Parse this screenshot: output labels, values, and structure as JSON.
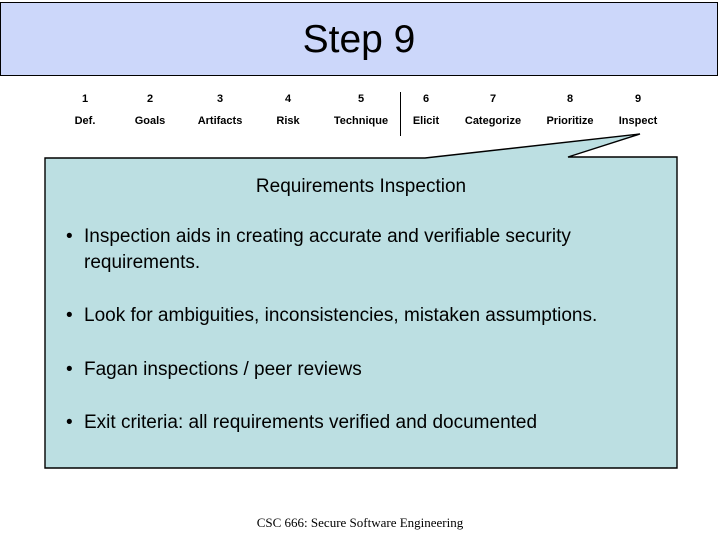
{
  "slide": {
    "title": "Step 9",
    "footer": "CSC 666: Secure Software Engineering",
    "banner_color": "#ccd7fa",
    "callout_color": "#bcdfe2",
    "border_color": "#000000"
  },
  "process_steps": [
    {
      "number": "1",
      "label": "Def."
    },
    {
      "number": "2",
      "label": "Goals"
    },
    {
      "number": "3",
      "label": "Artifacts"
    },
    {
      "number": "4",
      "label": "Risk"
    },
    {
      "number": "5",
      "label": "Technique"
    },
    {
      "number": "6",
      "label": "Elicit"
    },
    {
      "number": "7",
      "label": "Categorize"
    },
    {
      "number": "8",
      "label": "Prioritize"
    },
    {
      "number": "9",
      "label": "Inspect"
    }
  ],
  "callout": {
    "heading": "Requirements Inspection",
    "bullet_marker": "•",
    "bullets": [
      "Inspection aids in creating accurate and verifiable security requirements.",
      "Look for ambiguities, inconsistencies, mistaken assumptions.",
      "Fagan inspections / peer reviews",
      "Exit criteria: all requirements verified and documented"
    ]
  }
}
